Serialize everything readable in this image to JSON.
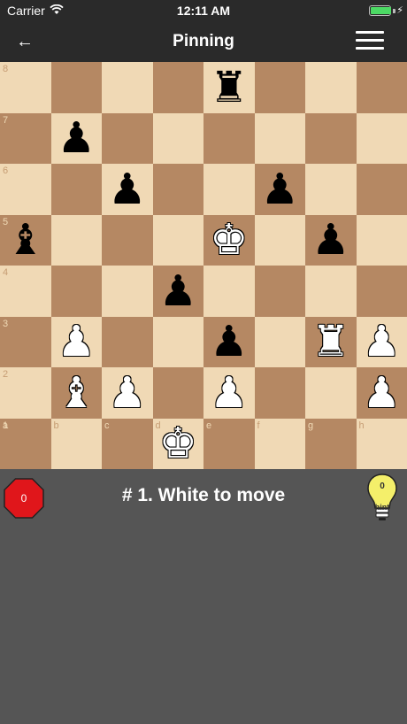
{
  "statusbar": {
    "carrier": "Carrier",
    "time": "12:11 AM",
    "battery_level": 1.0,
    "icons": [
      "wifi-icon",
      "battery-icon",
      "charging-icon"
    ]
  },
  "navbar": {
    "back_label": "←",
    "title": "Pinning",
    "icons": [
      "back-arrow-icon",
      "hamburger-menu-icon"
    ]
  },
  "board": {
    "files": [
      "a",
      "b",
      "c",
      "d",
      "e",
      "f",
      "g",
      "h"
    ],
    "ranks": [
      "8",
      "7",
      "6",
      "5",
      "4",
      "3",
      "2",
      "1"
    ],
    "pieces": [
      {
        "square": "e8",
        "color": "b",
        "symbol": "♜"
      },
      {
        "square": "b7",
        "color": "b",
        "symbol": "♟"
      },
      {
        "square": "c6",
        "color": "b",
        "symbol": "♟"
      },
      {
        "square": "f6",
        "color": "b",
        "symbol": "♟"
      },
      {
        "square": "a5",
        "color": "b",
        "symbol": "♝"
      },
      {
        "square": "e5",
        "color": "w",
        "symbol": "♚"
      },
      {
        "square": "g5",
        "color": "b",
        "symbol": "♟"
      },
      {
        "square": "d4",
        "color": "b",
        "symbol": "♟"
      },
      {
        "square": "b3",
        "color": "w",
        "symbol": "♟"
      },
      {
        "square": "e3",
        "color": "b",
        "symbol": "♟"
      },
      {
        "square": "g3",
        "color": "w",
        "symbol": "♜"
      },
      {
        "square": "h3",
        "color": "w",
        "symbol": "♟"
      },
      {
        "square": "b2",
        "color": "w",
        "symbol": "♝"
      },
      {
        "square": "c2",
        "color": "w",
        "symbol": "♟"
      },
      {
        "square": "e2",
        "color": "w",
        "symbol": "♟"
      },
      {
        "square": "h2",
        "color": "w",
        "symbol": "♟"
      },
      {
        "square": "d1",
        "color": "w",
        "symbol": "♚"
      }
    ]
  },
  "info": {
    "mistakes_count": "0",
    "prompt": "# 1. White to move",
    "hint_count": "0",
    "hint_label": "hint",
    "icons": [
      "stop-sign-icon",
      "lightbulb-hint-icon"
    ],
    "colors": {
      "stop": "#e0161b",
      "bulb": "#f4ef6a"
    }
  }
}
